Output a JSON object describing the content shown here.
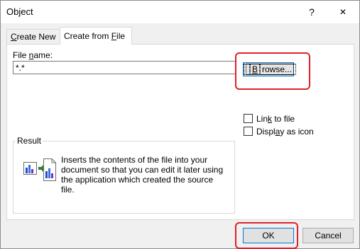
{
  "window": {
    "title": "Object",
    "help_glyph": "?",
    "close_glyph": "✕"
  },
  "tabs": [
    {
      "label_pre": "",
      "label_key": "C",
      "label_post": "reate New"
    },
    {
      "label_pre": "Create from ",
      "label_key": "F",
      "label_post": "ile"
    }
  ],
  "file": {
    "label_pre": "File ",
    "label_key": "n",
    "label_post": "ame:",
    "value": "*.*",
    "browse_pre": "",
    "browse_key": "B",
    "browse_post": "rowse..."
  },
  "options": {
    "link_pre": "Lin",
    "link_key": "k",
    "link_post": " to file",
    "display_pre": "Displ",
    "display_key": "a",
    "display_post": "y as icon"
  },
  "result": {
    "label": "Result",
    "text": "Inserts the contents of the file into your document so that you can edit it later using the application which created the source file."
  },
  "buttons": {
    "ok": "OK",
    "cancel": "Cancel"
  },
  "colors": {
    "highlight": "#e0202a",
    "focus": "#0078d7"
  }
}
